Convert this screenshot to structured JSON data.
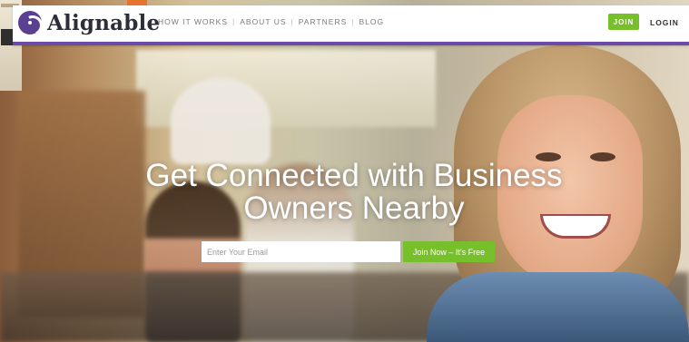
{
  "brand": {
    "name": "Alignable",
    "accent": "#6c4aa8",
    "green": "#78bf2c"
  },
  "nav": {
    "links": [
      "HOW IT WORKS",
      "ABOUT US",
      "PARTNERS",
      "BLOG"
    ],
    "join_label": "JOIN",
    "login_label": "LOGIN"
  },
  "hero": {
    "headline_line1": "Get Connected with Business",
    "headline_line2": "Owners Nearby",
    "email_placeholder": "Enter Your Email",
    "cta_label": "Join Now – It's Free"
  }
}
